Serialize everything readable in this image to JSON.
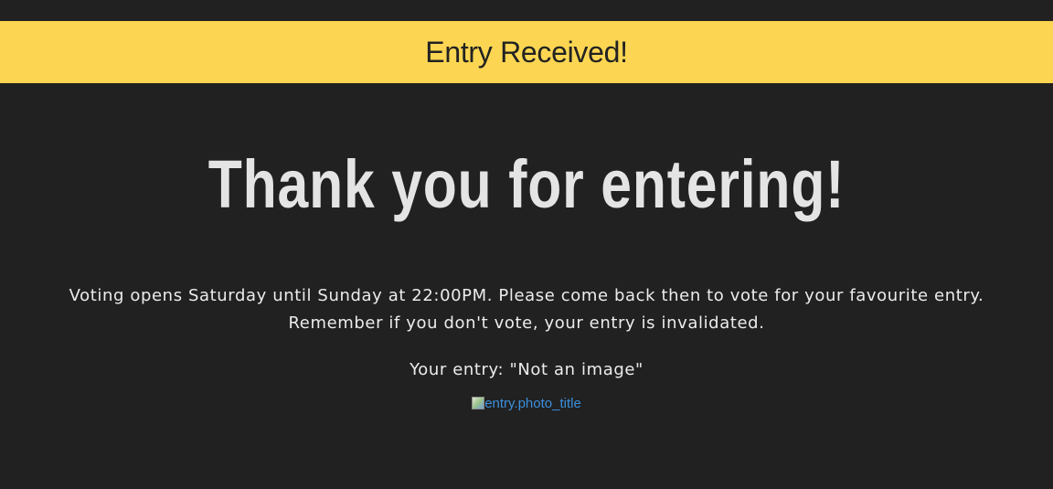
{
  "banner": {
    "text": "Entry Received!",
    "background": "#fcd652"
  },
  "main": {
    "headline": "Thank you for entering!",
    "info_line_1": "Voting opens Saturday until Sunday at 22:00PM. Please come back then to vote for your favourite entry.",
    "info_line_2": "Remember if you don't vote, your entry is invalidated.",
    "entry_line": "Your entry: \"Not an image\"",
    "photo_alt": "entry.photo_title",
    "photo_icon": "broken-image-icon"
  },
  "colors": {
    "page_background": "#212121",
    "text": "#ececec",
    "link": "#3b8fdc"
  }
}
